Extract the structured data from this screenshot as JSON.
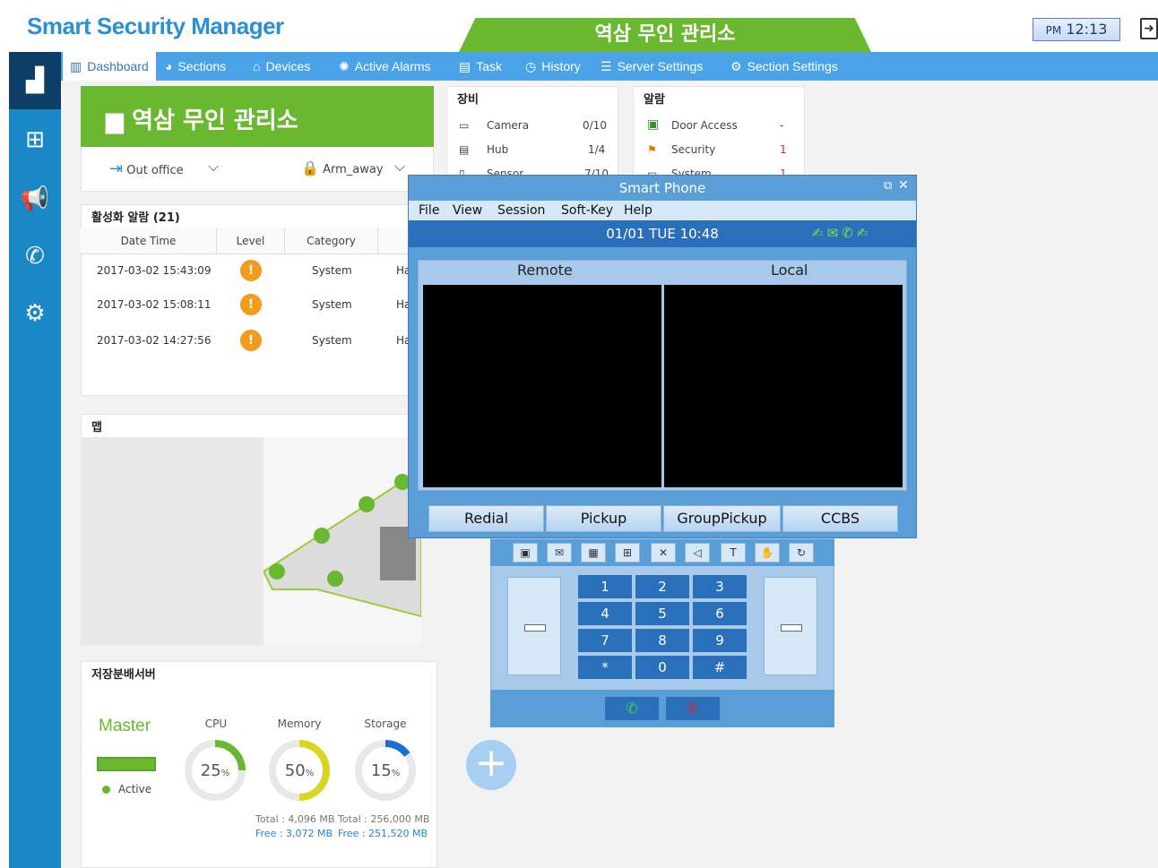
{
  "app": {
    "title": "Smart Security Manager",
    "site_tab": "역삼 무인 관리소",
    "clock_ampm": "PM",
    "clock_time": "12:13"
  },
  "nav": {
    "items": [
      {
        "label": "Dashboard",
        "icon": "bar-chart-icon"
      },
      {
        "label": "Sections",
        "icon": "sections-icon"
      },
      {
        "label": "Devices",
        "icon": "devices-icon"
      },
      {
        "label": "Active Alarms",
        "icon": "siren-icon"
      },
      {
        "label": "Task",
        "icon": "task-icon"
      },
      {
        "label": "History",
        "icon": "clock-icon"
      },
      {
        "label": "Server Settings",
        "icon": "server-settings-icon"
      },
      {
        "label": "Section Settings",
        "icon": "section-settings-icon"
      }
    ]
  },
  "site": {
    "name": "역삼 무인 관리소",
    "mode": "Out office",
    "arm": "Arm_away"
  },
  "equipment": {
    "title": "장비",
    "rows": [
      {
        "name": "Camera",
        "value": "0/10"
      },
      {
        "name": "Hub",
        "value": "1/4"
      },
      {
        "name": "Sensor",
        "value": "7/10"
      }
    ]
  },
  "alarms": {
    "title": "알람",
    "rows": [
      {
        "name": "Door Access",
        "value": "-"
      },
      {
        "name": "Security",
        "value": "1"
      },
      {
        "name": "System",
        "value": "1"
      }
    ]
  },
  "active_alarms": {
    "title": "활성화 알람 (21)",
    "columns": [
      "Date Time",
      "Level",
      "Category"
    ],
    "rows": [
      {
        "datetime": "2017-03-02 15:43:09",
        "category": "System",
        "extra": "Ha"
      },
      {
        "datetime": "2017-03-02 15:08:11",
        "category": "System",
        "extra": "Ha"
      },
      {
        "datetime": "2017-03-02 14:27:56",
        "category": "System",
        "extra": "Ha"
      }
    ]
  },
  "map": {
    "title": "맵"
  },
  "storage": {
    "title": "저장분배서버",
    "server": "Master",
    "status": "Active",
    "cpu_label": "CPU",
    "cpu": "25",
    "memory_label": "Memory",
    "memory": "50",
    "storage_label": "Storage",
    "storage": "15",
    "pct": "%",
    "mem_total": "Total : 4,096 MB",
    "mem_free": "Free : 3,072 MB",
    "sto_total": "Total : 256,000 MB",
    "sto_free": "Free : 251,520 MB"
  },
  "phone": {
    "title": "Smart Phone",
    "menu": [
      "File",
      "View",
      "Session",
      "Soft-Key",
      "Help"
    ],
    "status": "01/01  TUE  10:48",
    "remote": "Remote",
    "local": "Local",
    "softkeys": [
      "Redial",
      "Pickup",
      "GroupPickup",
      "CCBS"
    ],
    "keys": [
      "1",
      "2",
      "3",
      "4",
      "5",
      "6",
      "7",
      "8",
      "9",
      "*",
      "0",
      "#"
    ]
  },
  "colors": {
    "green": "#6ab82f",
    "blue": "#1a88c6",
    "nav": "#4aa3e6",
    "warn": "#f39b1c"
  }
}
